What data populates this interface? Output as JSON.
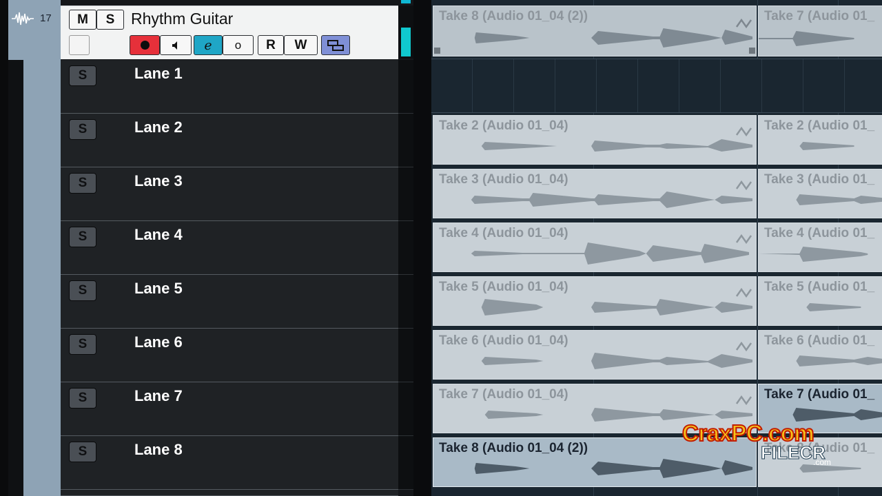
{
  "track": {
    "number": "17",
    "name": "Rhythm Guitar",
    "mute_label": "M",
    "solo_label": "S",
    "read_label": "R",
    "write_label": "W",
    "edit_label": "e",
    "monitor_label": "o"
  },
  "lanes": [
    {
      "label": "Lane 1",
      "solo": "S"
    },
    {
      "label": "Lane 2",
      "solo": "S"
    },
    {
      "label": "Lane 3",
      "solo": "S"
    },
    {
      "label": "Lane 4",
      "solo": "S"
    },
    {
      "label": "Lane 5",
      "solo": "S"
    },
    {
      "label": "Lane 6",
      "solo": "S"
    },
    {
      "label": "Lane 7",
      "solo": "S"
    },
    {
      "label": "Lane 8",
      "solo": "S"
    }
  ],
  "clips": {
    "top_left": "Take 8 (Audio 01_04 (2))",
    "top_right": "Take 7 (Audio 01_",
    "lane2_left": "Take 2 (Audio 01_04)",
    "lane2_right": "Take 2 (Audio 01_",
    "lane3_left": "Take 3 (Audio 01_04)",
    "lane3_right": "Take 3 (Audio 01_",
    "lane4_left": "Take 4 (Audio 01_04)",
    "lane4_right": "Take 4 (Audio 01_",
    "lane5_left": "Take 5 (Audio 01_04)",
    "lane5_right": "Take 5 (Audio 01_",
    "lane6_left": "Take 6 (Audio 01_04)",
    "lane6_right": "Take 6 (Audio 01_",
    "lane7_left": "Take 7 (Audio 01_04)",
    "lane7_right": "Take 7 (Audio 01_",
    "lane8_left": "Take 8 (Audio 01_04 (2))",
    "lane8_right": "Take 8 (Audio 01_"
  },
  "watermark": {
    "brand": "CraxPC.com",
    "sub": "FILECR",
    "sub_tld": ".com"
  },
  "colors": {
    "record": "#e6303a",
    "meter": "#10c9cf",
    "edit_active": "#1fa6c6",
    "group_active": "#7f8fd6"
  }
}
